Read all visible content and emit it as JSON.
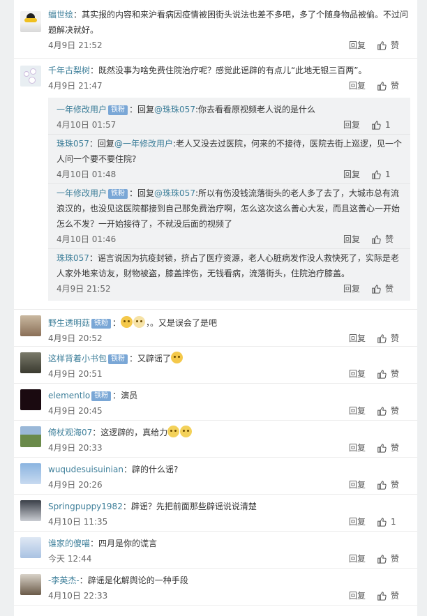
{
  "actions": {
    "reply": "回复",
    "like_zero": "赞"
  },
  "comments": [
    {
      "user": "蝠世绘",
      "text": "其实报的内容和来沪看病因疫情被困街头说法也差不多吧，多了个随身物品被偷。不过问题解决就好。",
      "time": "4月9日 21:52",
      "likes": "赞",
      "avatar_label": "首届上海 点我头像"
    },
    {
      "user": "千年古梨树",
      "text": "既然没事为啥免费住院治疗呢？感觉此谣辟的有点儿“此地无银三百两”。",
      "time": "4月9日 21:47",
      "likes": "赞",
      "replies": [
        {
          "user": "一年修改用户",
          "badge": "铁粉",
          "pre": "回复",
          "at": "@珠珠057",
          "text": ":你去看看原视频老人说的是什么",
          "time": "4月10日 01:57",
          "likes": "1"
        },
        {
          "user": "珠珠057",
          "pre": "回复",
          "at": "@一年修改用户",
          "text": ":老人又没去过医院，何来的不接待，医院去街上巡逻，见一个人问一个要不要住院?",
          "time": "4月10日 01:48",
          "likes": "1"
        },
        {
          "user": "一年修改用户",
          "badge": "铁粉",
          "pre": "回复",
          "at": "@珠珠057",
          "text": ":所以有伤没钱流落街头的老人多了去了，大城市总有流浪汉的，也没见这医院都接到自己那免费治疗啊，怎么这次这么善心大发，而且这善心一开始怎么不发？一开始接待了，不就没后面的视频了",
          "time": "4月10日 01:46",
          "likes": "赞"
        },
        {
          "user": "珠珠057",
          "pre": "",
          "at": "",
          "text": "谣言说因为抗疫封锁，挤占了医疗资源，老人心脏病发作没人救快死了，实际是老人家外地来访友，财物被盗，膝盖摔伤，无钱看病，流落街头，住院治疗膝盖。",
          "time": "4月9日 21:52",
          "likes": "赞"
        }
      ]
    },
    {
      "user": "野生透明菇",
      "badge": "铁粉",
      "text": "。又是误会了是吧",
      "emojis": [
        "emoji-1",
        "emoji-2"
      ],
      "time": "4月9日 20:52",
      "likes": "赞"
    },
    {
      "user": "这样背着小书包",
      "badge": "铁粉",
      "text": "又辟谣了",
      "emojis_after": [
        "emoji-3"
      ],
      "time": "4月9日 20:51",
      "likes": "赞"
    },
    {
      "user": "elementlo",
      "badge": "铁粉",
      "text": "演员",
      "time": "4月9日 20:45",
      "likes": "赞"
    },
    {
      "user": "倚杖观海07",
      "text": "这逻辟的，真给力",
      "emojis_after": [
        "emoji-4",
        "emoji-5"
      ],
      "time": "4月9日 20:33",
      "likes": "赞"
    },
    {
      "user": "wuqudesuisuinian",
      "text": "辟的什么谣?",
      "time": "4月9日 20:26",
      "likes": "赞"
    },
    {
      "user": "Springpuppy1982",
      "text": "辟谣？先把前面那些辟谣说说清楚",
      "time": "4月10日 11:35",
      "likes": "1"
    },
    {
      "user": "谁家的傻喵",
      "text": "四月是你的谎言",
      "time": "今天 12:44",
      "likes": "赞"
    },
    {
      "user": "-李英杰-",
      "text": "辟谣是化解舆论的一种手段",
      "time": "4月10日 22:33",
      "likes": "赞"
    }
  ],
  "colors": {
    "username": "#3e7f9a",
    "badge": "#7aa7d6",
    "sub_bg": "#f1f2f3"
  }
}
